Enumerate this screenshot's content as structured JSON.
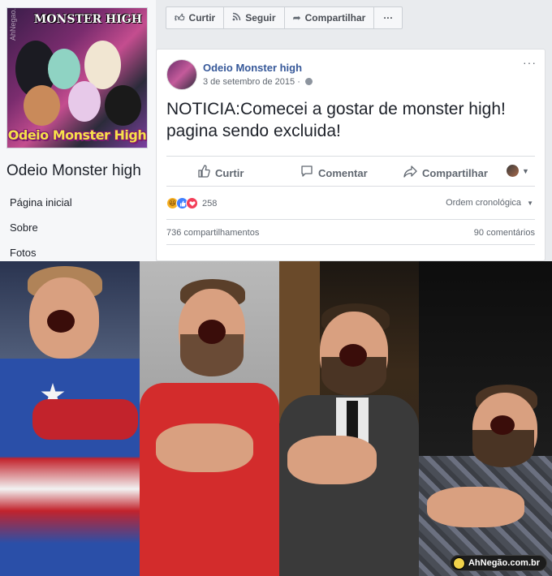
{
  "sidebar": {
    "cover_title": "MONSTER HIGH",
    "cover_watermark": "AhNegao.com.br",
    "cover_caption": "Odeio Monster High",
    "page_name": "Odeio Monster high",
    "nav": [
      "Página inicial",
      "Sobre",
      "Fotos"
    ]
  },
  "topbar": {
    "like": "Curtir",
    "follow": "Seguir",
    "share": "Compartilhar",
    "more": "···"
  },
  "post": {
    "author": "Odeio Monster high",
    "date": "3 de setembro de 2015 ·",
    "more": "···",
    "text": "NOTICIA:Comecei a gostar de monster high! pagina sendo excluida!",
    "actions": {
      "like": "Curtir",
      "comment": "Comentar",
      "share": "Compartilhar"
    },
    "reaction_count": "258",
    "order_label": "Ordem cronológica",
    "shares": "736 compartilhamentos",
    "comments": "90 comentários"
  },
  "meme": {
    "credit": "AhNegão.com.br"
  },
  "colors": {
    "fb_bg": "#e9ebee",
    "link_blue": "#365899",
    "like_blue": "#4080ff",
    "love_red": "#f33e58",
    "haha_yellow": "#f7b125"
  }
}
